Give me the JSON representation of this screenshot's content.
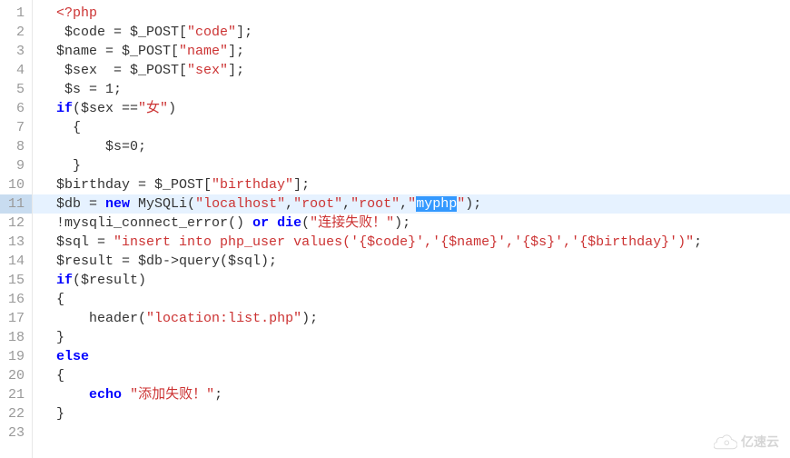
{
  "editor": {
    "active_line": 11,
    "lines": [
      {
        "n": 1,
        "indent": 2,
        "tokens": [
          {
            "t": "php-tag",
            "v": "<?php"
          }
        ]
      },
      {
        "n": 2,
        "indent": 2,
        "tokens": [
          {
            "t": "var",
            "v": " $code = $_POST["
          },
          {
            "t": "str",
            "v": "\"code\""
          },
          {
            "t": "var",
            "v": "];"
          }
        ]
      },
      {
        "n": 3,
        "indent": 2,
        "tokens": [
          {
            "t": "var",
            "v": "$name = $_POST["
          },
          {
            "t": "str",
            "v": "\"name\""
          },
          {
            "t": "var",
            "v": "];"
          }
        ]
      },
      {
        "n": 4,
        "indent": 2,
        "tokens": [
          {
            "t": "var",
            "v": " $sex  = $_POST["
          },
          {
            "t": "str",
            "v": "\"sex\""
          },
          {
            "t": "var",
            "v": "];"
          }
        ]
      },
      {
        "n": 5,
        "indent": 2,
        "tokens": [
          {
            "t": "var",
            "v": " $s = 1;"
          }
        ]
      },
      {
        "n": 6,
        "indent": 2,
        "tokens": [
          {
            "t": "k",
            "v": "if"
          },
          {
            "t": "var",
            "v": "($sex =="
          },
          {
            "t": "str",
            "v": "\"女\""
          },
          {
            "t": "var",
            "v": ")"
          }
        ]
      },
      {
        "n": 7,
        "indent": 2,
        "tokens": [
          {
            "t": "var",
            "v": "  {"
          }
        ]
      },
      {
        "n": 8,
        "indent": 2,
        "tokens": [
          {
            "t": "var",
            "v": "      $s=0;"
          }
        ]
      },
      {
        "n": 9,
        "indent": 2,
        "tokens": [
          {
            "t": "var",
            "v": "  }"
          }
        ]
      },
      {
        "n": 10,
        "indent": 2,
        "tokens": [
          {
            "t": "var",
            "v": "$birthday = $_POST["
          },
          {
            "t": "str",
            "v": "\"birthday\""
          },
          {
            "t": "var",
            "v": "];"
          }
        ]
      },
      {
        "n": 11,
        "indent": 2,
        "highlight": true,
        "tokens": [
          {
            "t": "var",
            "v": "$db = "
          },
          {
            "t": "k",
            "v": "new"
          },
          {
            "t": "var",
            "v": " MySQLi("
          },
          {
            "t": "str",
            "v": "\"localhost\""
          },
          {
            "t": "var",
            "v": ","
          },
          {
            "t": "str",
            "v": "\"root\""
          },
          {
            "t": "var",
            "v": ","
          },
          {
            "t": "str",
            "v": "\"root\""
          },
          {
            "t": "var",
            "v": ","
          },
          {
            "t": "str",
            "v": "\""
          },
          {
            "t": "sel",
            "v": "myphp"
          },
          {
            "t": "str",
            "v": "\""
          },
          {
            "t": "var",
            "v": ");"
          }
        ]
      },
      {
        "n": 12,
        "indent": 2,
        "tokens": [
          {
            "t": "var",
            "v": "!mysqli_connect_error() "
          },
          {
            "t": "k",
            "v": "or"
          },
          {
            "t": "var",
            "v": " "
          },
          {
            "t": "k",
            "v": "die"
          },
          {
            "t": "var",
            "v": "("
          },
          {
            "t": "str",
            "v": "\"连接失败！\""
          },
          {
            "t": "var",
            "v": ");"
          }
        ]
      },
      {
        "n": 13,
        "indent": 2,
        "tokens": [
          {
            "t": "var",
            "v": "$sql = "
          },
          {
            "t": "str",
            "v": "\"insert into php_user values('{$code}','{$name}','{$s}','{$birthday}')\""
          },
          {
            "t": "var",
            "v": ";"
          }
        ]
      },
      {
        "n": 14,
        "indent": 2,
        "tokens": [
          {
            "t": "var",
            "v": "$result = $db->query($sql);"
          }
        ]
      },
      {
        "n": 15,
        "indent": 2,
        "tokens": [
          {
            "t": "k",
            "v": "if"
          },
          {
            "t": "var",
            "v": "($result)"
          }
        ]
      },
      {
        "n": 16,
        "indent": 2,
        "tokens": [
          {
            "t": "var",
            "v": "{"
          }
        ]
      },
      {
        "n": 17,
        "indent": 2,
        "tokens": [
          {
            "t": "var",
            "v": "    header("
          },
          {
            "t": "str",
            "v": "\"location:list.php\""
          },
          {
            "t": "var",
            "v": ");"
          }
        ]
      },
      {
        "n": 18,
        "indent": 2,
        "tokens": [
          {
            "t": "var",
            "v": "}"
          }
        ]
      },
      {
        "n": 19,
        "indent": 2,
        "tokens": [
          {
            "t": "k",
            "v": "else"
          }
        ]
      },
      {
        "n": 20,
        "indent": 2,
        "tokens": [
          {
            "t": "var",
            "v": "{"
          }
        ]
      },
      {
        "n": 21,
        "indent": 2,
        "tokens": [
          {
            "t": "var",
            "v": "    "
          },
          {
            "t": "k",
            "v": "echo"
          },
          {
            "t": "var",
            "v": " "
          },
          {
            "t": "str",
            "v": "\"添加失败！\""
          },
          {
            "t": "var",
            "v": ";"
          }
        ]
      },
      {
        "n": 22,
        "indent": 2,
        "tokens": [
          {
            "t": "var",
            "v": "}"
          }
        ]
      },
      {
        "n": 23,
        "indent": 2,
        "tokens": []
      }
    ]
  },
  "watermark": {
    "text": "亿速云"
  }
}
